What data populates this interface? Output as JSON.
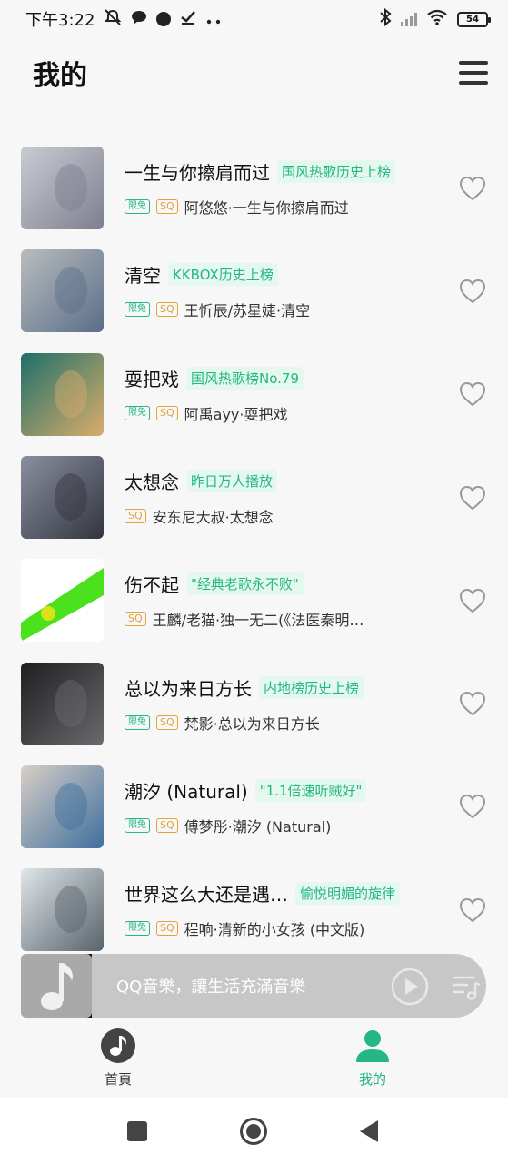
{
  "status_bar": {
    "time": "下午3:22",
    "battery": "54"
  },
  "header": {
    "title": "我的"
  },
  "songs": [
    {
      "title": "一生与你擦肩而过",
      "tag": "国风热歌历史上榜",
      "free": "限免",
      "sq": "SQ",
      "artist": "阿悠悠·一生与你擦肩而过",
      "cover_colors": [
        "#c9cbd3",
        "#7d7f8e"
      ]
    },
    {
      "title": "清空",
      "tag": "KKBOX历史上榜",
      "free": "限免",
      "sq": "SQ",
      "artist": "王忻辰/苏星婕·清空",
      "cover_colors": [
        "#b9bcbc",
        "#5a6e8a"
      ]
    },
    {
      "title": "耍把戏",
      "tag": "国风热歌榜No.79",
      "free": "限免",
      "sq": "SQ",
      "artist": "阿禹ayy·耍把戏",
      "cover_colors": [
        "#1e6f6a",
        "#d9ad6b"
      ]
    },
    {
      "title": "太想念",
      "tag": "昨日万人播放",
      "free": "",
      "sq": "SQ",
      "artist": "安东尼大叔·太想念",
      "cover_colors": [
        "#8a8fa0",
        "#33363f"
      ]
    },
    {
      "title": "伤不起",
      "tag": "\"经典老歌永不败\"",
      "free": "",
      "sq": "SQ",
      "artist": "王麟/老猫·独一无二(《法医秦明之…",
      "cover_colors": [
        "#ffffff",
        "#4be11c"
      ]
    },
    {
      "title": "总以为来日方长",
      "tag": "内地榜历史上榜",
      "free": "限免",
      "sq": "SQ",
      "artist": "梵影·总以为来日方长",
      "cover_colors": [
        "#1f1f21",
        "#6a6a6e"
      ]
    },
    {
      "title": "潮汐 (Natural)",
      "tag": "\"1.1倍速听贼好\"",
      "free": "限免",
      "sq": "SQ",
      "artist": "傅梦彤·潮汐 (Natural)",
      "cover_colors": [
        "#d8cec6",
        "#3f6f9e"
      ]
    },
    {
      "title": "世界这么大还是遇…",
      "tag": "愉悦明媚的旋律",
      "free": "限免",
      "sq": "SQ",
      "artist": "程响·清新的小女孩 (中文版)",
      "cover_colors": [
        "#dfe6ea",
        "#59636b"
      ]
    }
  ],
  "player": {
    "text": "QQ音樂，讓生活充滿音樂"
  },
  "nav": {
    "home_label": "首頁",
    "mine_label": "我的"
  },
  "colors": {
    "accent": "#24b783",
    "tag_bg": "#e4f8ef",
    "sq": "#e3a13c"
  }
}
